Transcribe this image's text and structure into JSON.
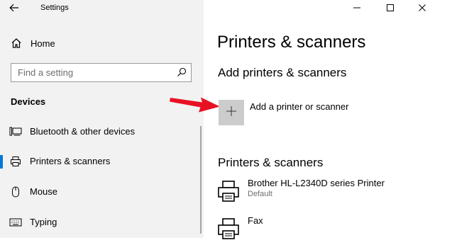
{
  "window": {
    "app_title": "Settings",
    "controls": [
      "minimize",
      "maximize",
      "close"
    ]
  },
  "sidebar": {
    "home_label": "Home",
    "search": {
      "placeholder": "Find a setting"
    },
    "section_heading": "Devices",
    "items": [
      {
        "label": "Bluetooth & other devices",
        "icon": "bluetooth-devices-icon",
        "selected": false
      },
      {
        "label": "Printers & scanners",
        "icon": "printer-icon",
        "selected": true
      },
      {
        "label": "Mouse",
        "icon": "mouse-icon",
        "selected": false
      },
      {
        "label": "Typing",
        "icon": "keyboard-icon",
        "selected": false
      }
    ]
  },
  "main": {
    "page_title": "Printers & scanners",
    "add_section_heading": "Add printers & scanners",
    "add_button_label": "Add a printer or scanner",
    "list_heading": "Printers & scanners",
    "printers": [
      {
        "name": "Brother HL-L2340D series Printer",
        "status": "Default"
      },
      {
        "name": "Fax",
        "status": ""
      }
    ]
  },
  "colors": {
    "sidebar_bg": "#f2f2f2",
    "accent": "#0078d7",
    "add_tile_bg": "#cccccc",
    "annotation_arrow": "#e81123",
    "secondary_text": "#6d6d6d"
  }
}
